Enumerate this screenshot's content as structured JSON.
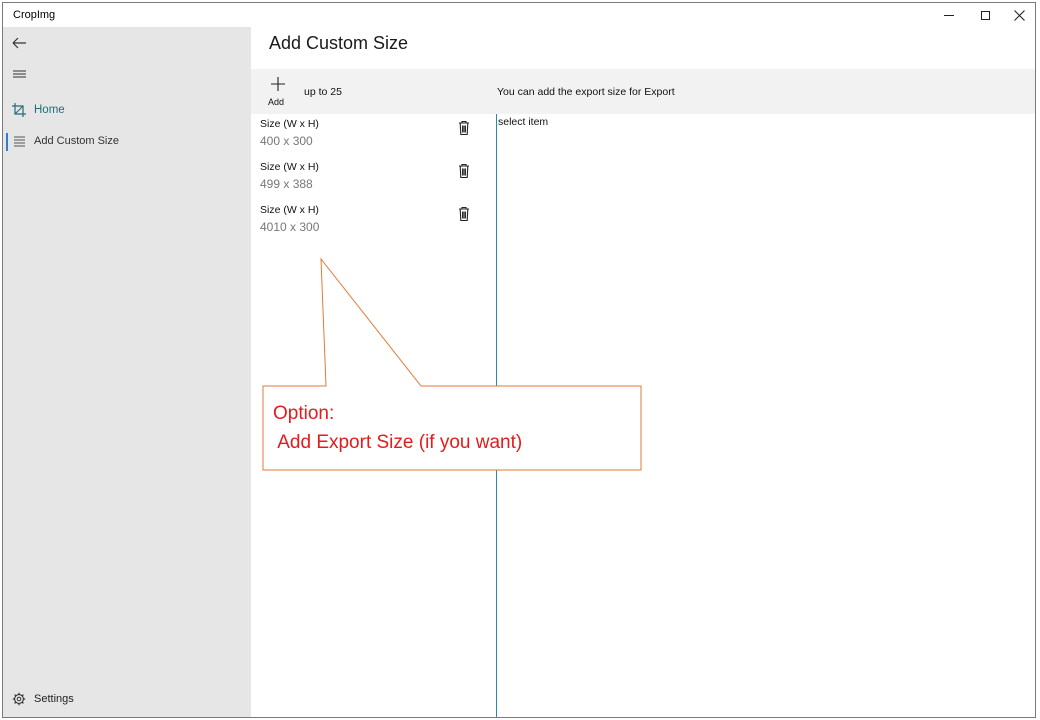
{
  "window": {
    "title": "CropImg"
  },
  "nav": {
    "items": [
      {
        "label": "Home",
        "icon": "crop-icon"
      },
      {
        "label": "Add Custom Size",
        "icon": "list-icon"
      }
    ],
    "settings_label": "Settings"
  },
  "page": {
    "title": "Add Custom Size",
    "add_label": "Add",
    "limit_text": "up to 25",
    "info_text": "You can add the export size for Export",
    "detail_placeholder": "select item"
  },
  "sizes": [
    {
      "caption": "Size (W x H)",
      "value": "400 x 300"
    },
    {
      "caption": "Size (W x H)",
      "value": "499 x 388"
    },
    {
      "caption": "Size (W x H)",
      "value": "4010 x 300"
    }
  ],
  "annotation": {
    "line1": "Option:",
    "line2": " Add Export Size (if you want)",
    "color": "#e31b1b",
    "border_color": "#e07b39"
  },
  "colors": {
    "accent": "#2a8aa6",
    "nav_bg": "#e6e6e6",
    "selected_indicator": "#2f7fd1"
  }
}
